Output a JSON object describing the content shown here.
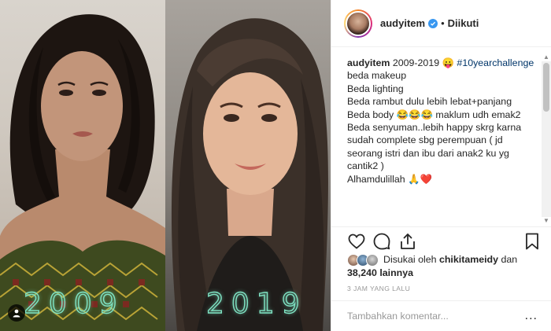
{
  "photo": {
    "year_left": "2009",
    "year_right": "2019",
    "tag_icon": "user-tag-icon"
  },
  "header": {
    "username": "audyitem",
    "verified": true,
    "separator": "•",
    "follow_status": "Diikuti"
  },
  "caption": {
    "author": "audyitem",
    "title_text": " 2009-2019 😛 ",
    "hashtag": "#10yearchallenge",
    "body": "beda makeup\nBeda lighting\nBeda rambut dulu lebih lebat+panjang\nBeda body 😂😂😂 maklum udh emak2\nBeda senyuman..lebih happy skrg karna sudah complete sbg perempuan ( jd seorang istri dan ibu dari anak2 ku yg cantik2 )\nAlhamdulillah 🙏❤️"
  },
  "likes": {
    "prefix": "Disukai oleh ",
    "liker": "chikitameidy",
    "conjunction": " dan",
    "count": "38,240 lainnya"
  },
  "timestamp": "3 JAM YANG LALU",
  "comment": {
    "placeholder": "Tambahkan komentar...",
    "more": "..."
  },
  "colors": {
    "year_outline": "#7fe3c3",
    "verified": "#3897f0",
    "hashtag": "#003569"
  }
}
